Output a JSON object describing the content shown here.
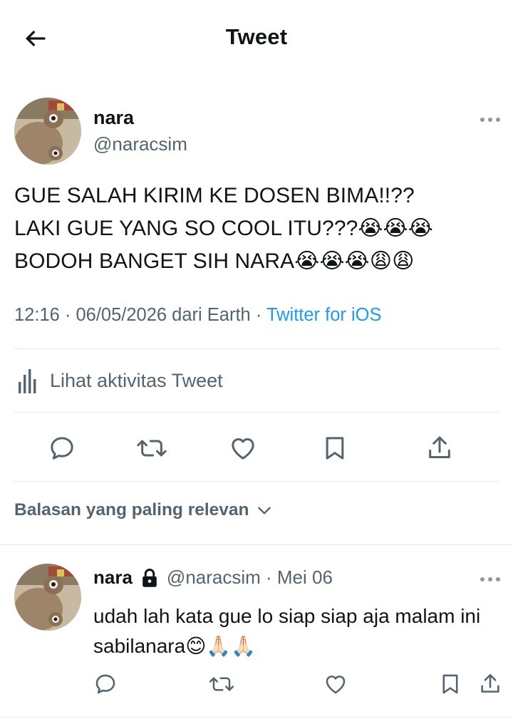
{
  "header": {
    "title": "Tweet"
  },
  "tweet": {
    "author_name": "nara",
    "author_handle": "@naracsim",
    "text": "GUE SALAH KIRIM KE DOSEN BIMA!!??\nLAKI GUE YANG SO COOL ITU???😭😭😭\nBODOH BANGET SIH NARA😭😭😭😩😩",
    "time_date": "12:16 · 06/05/2026 dari Earth · ",
    "source": "Twitter for iOS",
    "activity_label": "Lihat aktivitas Tweet"
  },
  "replies_sort": {
    "label": "Balasan yang paling relevan"
  },
  "reply": {
    "author_name": "nara",
    "author_handle": "@naracsim · Mei 06",
    "text": "udah lah kata gue lo siap siap aja malam ini sabilanara😊🙏🏻🙏🏻"
  },
  "icons": [
    "back-arrow-icon",
    "more-icon",
    "chart-icon",
    "reply-icon",
    "retweet-icon",
    "like-icon",
    "bookmark-icon",
    "share-icon",
    "chevron-down-icon",
    "lock-icon"
  ],
  "colors": {
    "link": "#1d9bf0",
    "secondary_text": "#536471",
    "primary_text": "#0f1419",
    "divider": "#e6e9ec"
  }
}
